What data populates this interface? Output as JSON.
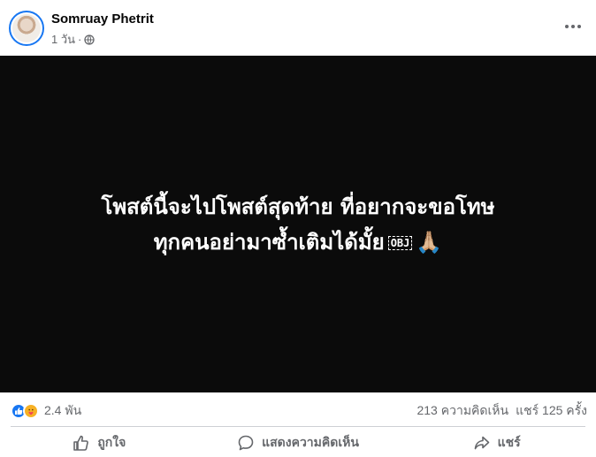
{
  "post": {
    "author": "Somruay Phetrit",
    "time": "1 วัน",
    "separator": "·",
    "audience_icon": "globe-icon",
    "more_icon": "more-options-icon"
  },
  "media": {
    "line1": "โพสต์นี้จะไปโพสต์สุดท้าย ที่อยากจะขอโทษ",
    "line2": "ทุกคนอย่ามาซ้ำเติมได้มั้ย",
    "obj_marker": "OBJ",
    "emoji": "🙏🏼"
  },
  "stats": {
    "reactions": [
      "like",
      "care"
    ],
    "reaction_count": "2.4 พัน",
    "comments": "213 ความคิดเห็น",
    "shares": "แชร์ 125 ครั้ง"
  },
  "actions": [
    {
      "label": "ถูกใจ",
      "icon": "like-icon"
    },
    {
      "label": "แสดงความคิดเห็น",
      "icon": "comment-icon"
    },
    {
      "label": "แชร์",
      "icon": "share-icon"
    }
  ],
  "colors": {
    "brand": "#1877f2",
    "secondary_text": "#65676b",
    "media_bg": "#0b0b0b",
    "care": "#f7b125"
  }
}
